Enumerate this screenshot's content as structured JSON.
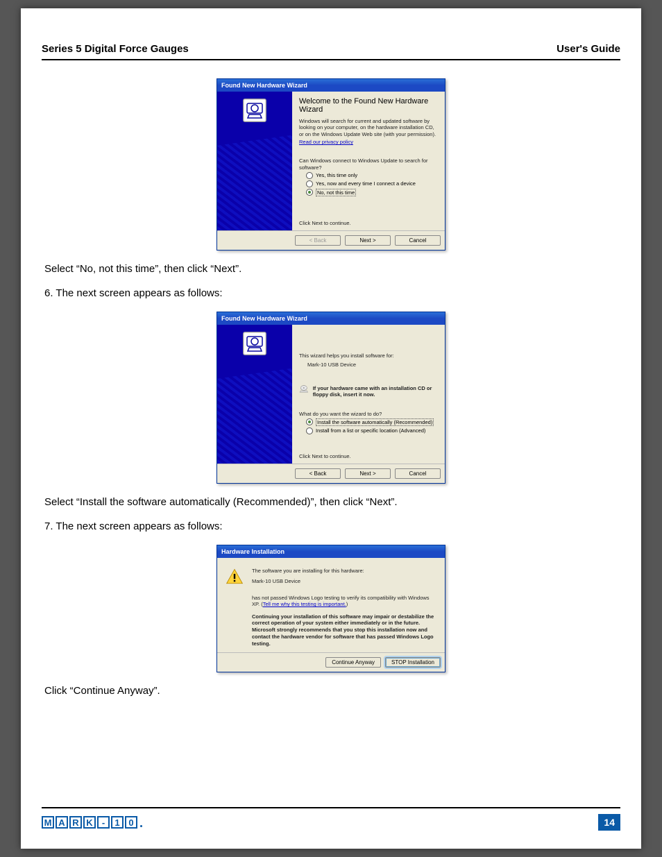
{
  "header": {
    "left": "Series 5 Digital Force Gauges",
    "right": "User's Guide"
  },
  "wizard1": {
    "title": "Found New Hardware Wizard",
    "heading": "Welcome to the Found New Hardware Wizard",
    "intro": "Windows will search for current and updated software by looking on your computer, on the hardware installation CD, or on the Windows Update Web site (with your permission).",
    "privacy": "Read our privacy policy",
    "question": "Can Windows connect to Windows Update to search for software?",
    "opt1": "Yes, this time only",
    "opt2": "Yes, now and every time I connect a device",
    "opt3": "No, not this time",
    "cont": "Click Next to continue.",
    "back": "< Back",
    "next": "Next >",
    "cancel": "Cancel"
  },
  "instr1": "Select “No, not this time”, then click “Next”.",
  "step6": "6. The next screen appears as follows:",
  "wizard2": {
    "title": "Found New Hardware Wizard",
    "line1": "This wizard helps you install software for:",
    "device": "Mark-10 USB Device",
    "cdnote": "If your hardware came with an installation CD or floppy disk, insert it now.",
    "question": "What do you want the wizard to do?",
    "opt1": "Install the software automatically (Recommended)",
    "opt2": "Install from a list or specific location (Advanced)",
    "cont": "Click Next to continue.",
    "back": "< Back",
    "next": "Next >",
    "cancel": "Cancel"
  },
  "instr2": "Select “Install the software automatically (Recommended)”, then click “Next”.",
  "step7": "7. The next screen appears as follows:",
  "hw": {
    "title": "Hardware Installation",
    "line1": "The software you are installing for this hardware:",
    "device": "Mark-10 USB Device",
    "line2a": "has not passed Windows Logo testing to verify its compatibility with Windows XP. (",
    "link": "Tell me why this testing is important.",
    "line2b": ")",
    "warn": "Continuing your installation of this software may impair or destabilize the correct operation of your system either immediately or in the future. Microsoft strongly recommends that you stop this installation now and contact the hardware vendor for software that has passed Windows Logo testing.",
    "cont": "Continue Anyway",
    "stop": "STOP Installation"
  },
  "instr3": "Click “Continue Anyway”.",
  "pagenum": "14",
  "logo": [
    "M",
    "A",
    "R",
    "K",
    "-",
    "1",
    "0"
  ]
}
